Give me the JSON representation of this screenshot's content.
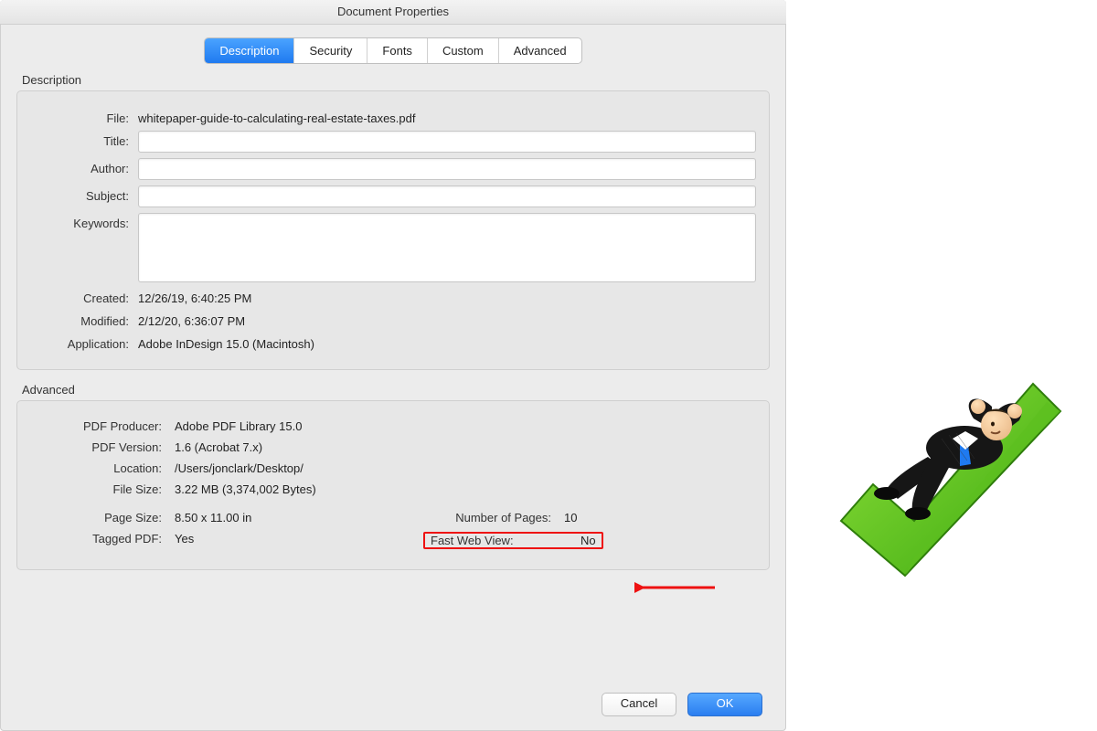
{
  "window": {
    "title": "Document Properties"
  },
  "tabs": {
    "description": "Description",
    "security": "Security",
    "fonts": "Fonts",
    "custom": "Custom",
    "advanced": "Advanced"
  },
  "section_labels": {
    "description": "Description",
    "advanced": "Advanced"
  },
  "labels": {
    "file": "File:",
    "title": "Title:",
    "author": "Author:",
    "subject": "Subject:",
    "keywords": "Keywords:",
    "created": "Created:",
    "modified": "Modified:",
    "application": "Application:",
    "pdf_producer": "PDF Producer:",
    "pdf_version": "PDF Version:",
    "location": "Location:",
    "file_size": "File Size:",
    "page_size": "Page Size:",
    "tagged_pdf": "Tagged PDF:",
    "num_pages": "Number of Pages:",
    "fast_web_view": "Fast Web View:"
  },
  "values": {
    "file": "whitepaper-guide-to-calculating-real-estate-taxes.pdf",
    "title": "",
    "author": "",
    "subject": "",
    "keywords": "",
    "created": "12/26/19, 6:40:25 PM",
    "modified": "2/12/20, 6:36:07 PM",
    "application": "Adobe InDesign 15.0 (Macintosh)",
    "pdf_producer": "Adobe PDF Library 15.0",
    "pdf_version": "1.6 (Acrobat 7.x)",
    "location": "/Users/jonclark/Desktop/",
    "file_size": "3.22 MB (3,374,002 Bytes)",
    "page_size": "8.50 x 11.00 in",
    "tagged_pdf": "Yes",
    "num_pages": "10",
    "fast_web_view": "No"
  },
  "buttons": {
    "cancel": "Cancel",
    "ok": "OK"
  },
  "annotation": {
    "arrow_color": "#e11"
  },
  "illustration": {
    "name": "businessman-reclining-on-checkmark"
  }
}
